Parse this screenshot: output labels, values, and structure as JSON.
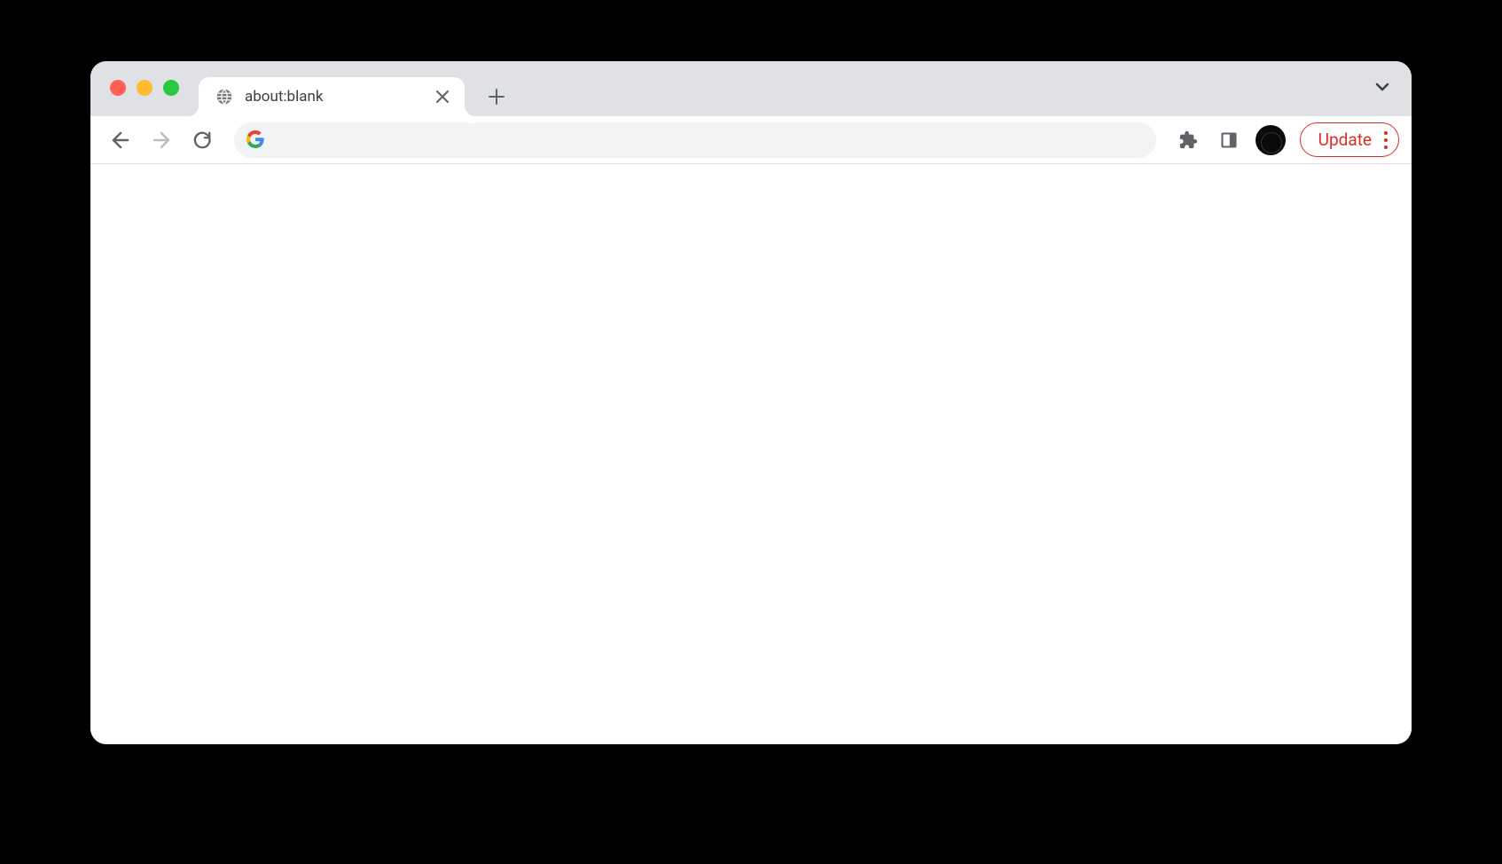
{
  "tab": {
    "title": "about:blank"
  },
  "addressBar": {
    "value": ""
  },
  "updateButton": {
    "label": "Update"
  }
}
